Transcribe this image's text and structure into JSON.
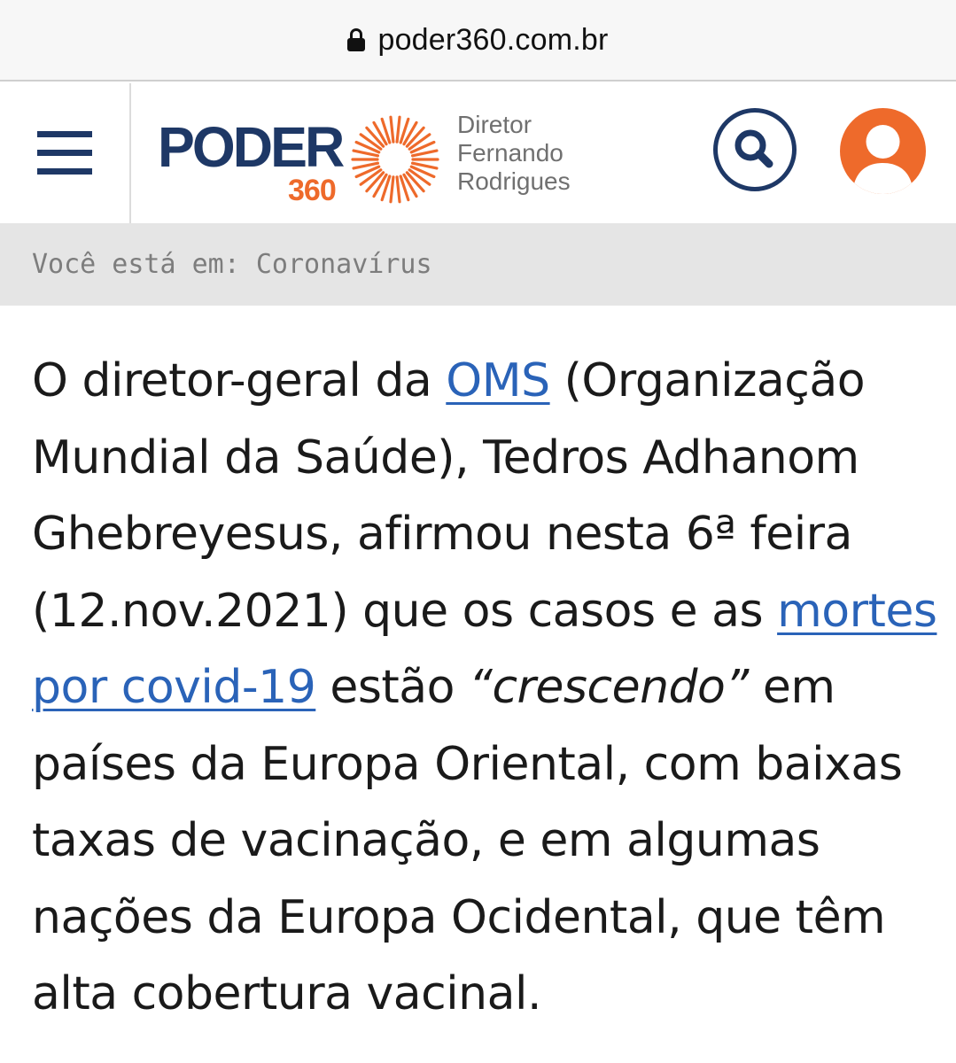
{
  "browser": {
    "url": "poder360.com.br"
  },
  "header": {
    "logo_word": "PODER",
    "logo_number": "360",
    "director_lines": [
      "Diretor",
      "Fernando",
      "Rodrigues"
    ]
  },
  "breadcrumb": {
    "text": "Você está em: Coronavírus"
  },
  "article": {
    "l1_a": "O diretor-geral da ",
    "l1_link": "OMS",
    "l1_b": " (Organização",
    "l2": "Mundial da Saúde), Tedros Adhanom",
    "l3": "Ghebreyesus, afirmou nesta 6ª feira",
    "l4_a": "(12.nov.2021) que os casos e as ",
    "l4_link": "mortes",
    "l5_link": "por covid-19",
    "l5_a": " estão ",
    "l5_em": "“crescendo”",
    "l5_b": " em",
    "l6": "países da Europa Oriental, com baixas",
    "l7": "taxas de vacinação, e em algumas",
    "l8": "nações da Europa Ocidental, que têm",
    "l9": "alta cobertura vacinal."
  },
  "colors": {
    "brand_blue": "#1e3866",
    "brand_orange": "#ee6a2b",
    "link": "#2a63b8"
  },
  "icons": [
    "lock-icon",
    "menu-icon",
    "sun-icon",
    "search-icon",
    "user-icon"
  ]
}
